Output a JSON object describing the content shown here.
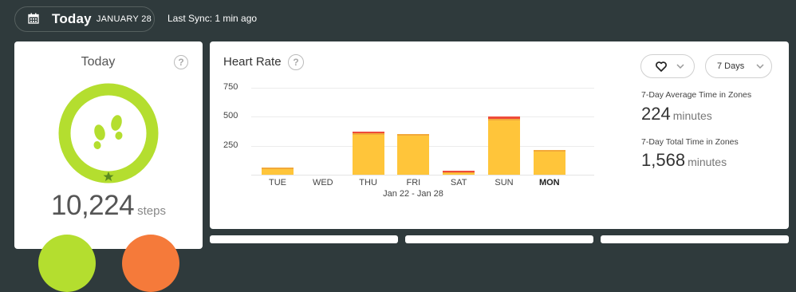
{
  "header": {
    "date_day": "Today",
    "date_month": "JANUARY 28",
    "sync_text": "Last Sync: 1 min ago"
  },
  "today_card": {
    "title": "Today",
    "help": "?",
    "steps_value": "10,224",
    "steps_unit": "steps",
    "goal_progress": 1.0
  },
  "heart_rate": {
    "title": "Heart Rate",
    "help": "?",
    "metric_icon": "heart-icon",
    "period_select": "7 Days",
    "stats": [
      {
        "label": "7-Day Average Time in Zones",
        "value": "224",
        "unit": "minutes"
      },
      {
        "label": "7-Day Total Time in Zones",
        "value": "1,568",
        "unit": "minutes"
      }
    ]
  },
  "chart_data": {
    "type": "bar",
    "categories": [
      "TUE",
      "WED",
      "THU",
      "FRI",
      "SAT",
      "SUN",
      "MON"
    ],
    "series": [
      {
        "values": [
          65,
          0,
          355,
          350,
          30,
          480,
          215
        ]
      },
      {
        "values": [
          0,
          0,
          15,
          0,
          5,
          25,
          0
        ]
      }
    ],
    "y_ticks": [
      "750",
      "500",
      "250"
    ],
    "ylim": [
      0,
      750
    ],
    "x_range_label": "Jan 22 - Jan 28",
    "highlight_category": "MON",
    "colors": {
      "fat_burn": "#ffc53a",
      "cardio": "#f58a3a",
      "peak": "#ee4b3a"
    }
  }
}
